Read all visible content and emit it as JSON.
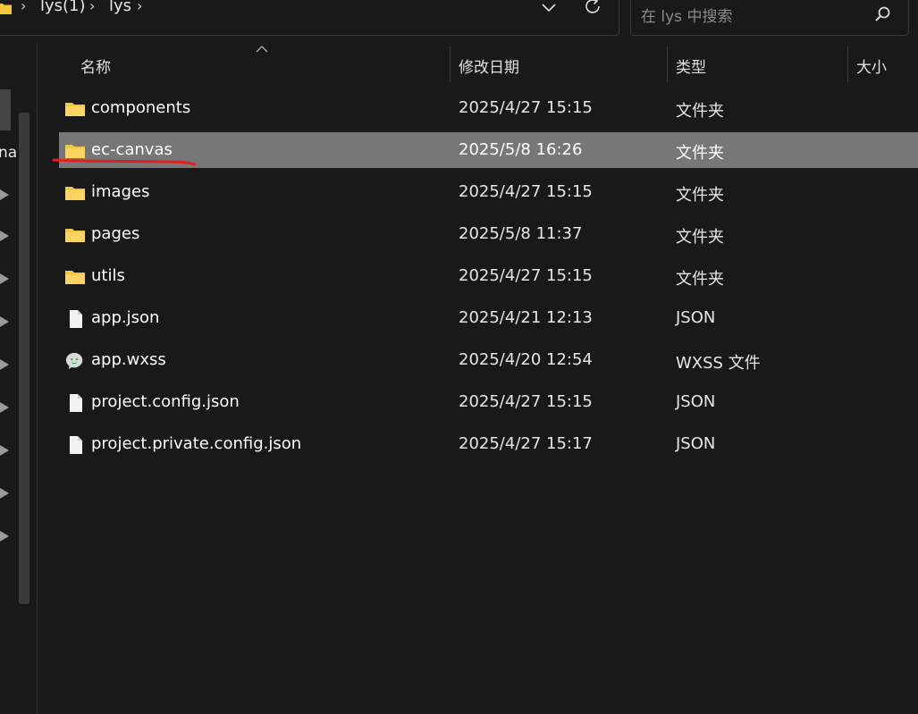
{
  "address_bar": {
    "crumbs": [
      "lys(1)",
      "lys"
    ],
    "separator": "›"
  },
  "search": {
    "placeholder": "在 lys 中搜索"
  },
  "nav": {
    "partial_label": "na"
  },
  "columns": {
    "name": "名称",
    "date": "修改日期",
    "type": "类型",
    "size": "大小"
  },
  "files": [
    {
      "name": "components",
      "date": "2025/4/27 15:15",
      "type": "文件夹",
      "icon": "folder-icon"
    },
    {
      "name": "ec-canvas",
      "date": "2025/5/8 16:26",
      "type": "文件夹",
      "icon": "folder-icon",
      "selected": true
    },
    {
      "name": "images",
      "date": "2025/4/27 15:15",
      "type": "文件夹",
      "icon": "folder-icon"
    },
    {
      "name": "pages",
      "date": "2025/5/8 11:37",
      "type": "文件夹",
      "icon": "folder-icon"
    },
    {
      "name": "utils",
      "date": "2025/4/27 15:15",
      "type": "文件夹",
      "icon": "folder-icon"
    },
    {
      "name": "app.json",
      "date": "2025/4/21 12:13",
      "type": "JSON",
      "icon": "file-icon"
    },
    {
      "name": "app.wxss",
      "date": "2025/4/20 12:54",
      "type": "WXSS 文件",
      "icon": "wechat-file-icon"
    },
    {
      "name": "project.config.json",
      "date": "2025/4/27 15:15",
      "type": "JSON",
      "icon": "file-icon"
    },
    {
      "name": "project.private.config.json",
      "date": "2025/4/27 15:17",
      "type": "JSON",
      "icon": "file-icon"
    }
  ],
  "colors": {
    "background": "#191919",
    "selected_row": "#777777",
    "folder": "#f5c542",
    "annotation": "#e02020"
  }
}
